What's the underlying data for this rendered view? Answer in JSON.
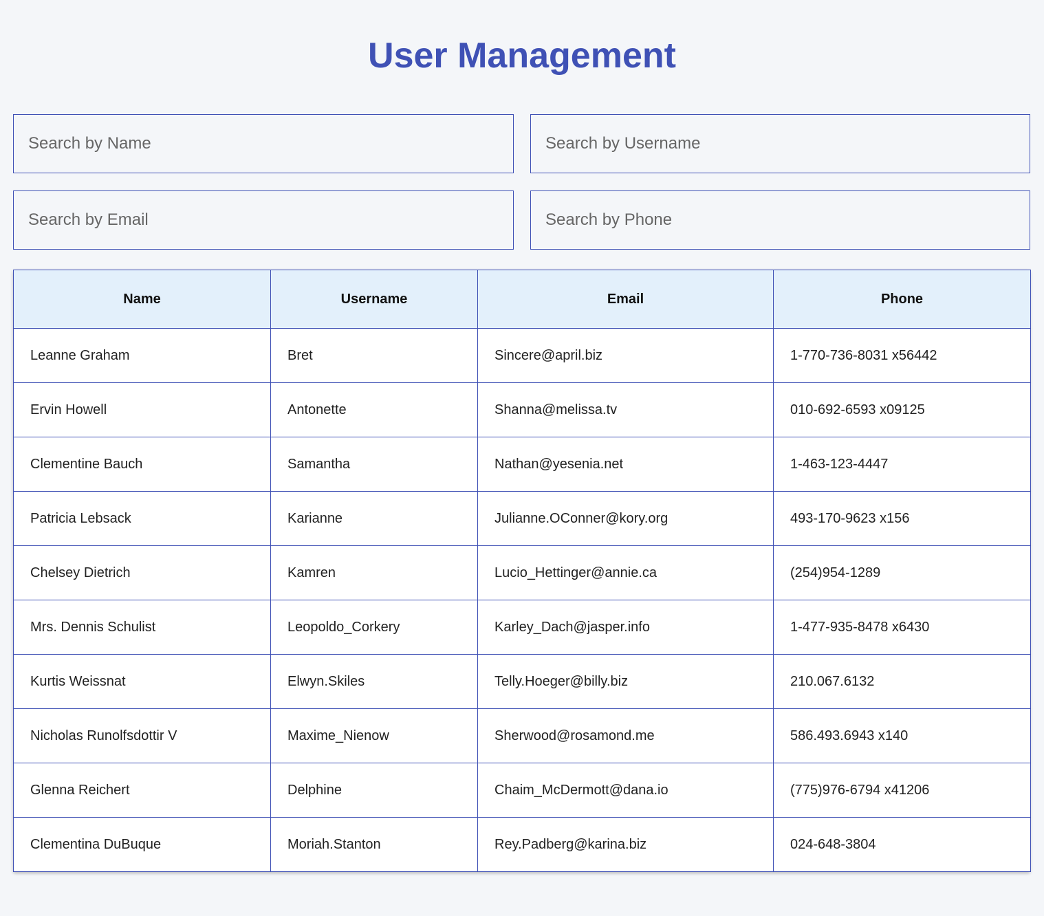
{
  "header": {
    "title": "User Management"
  },
  "filters": {
    "name_placeholder": "Search by Name",
    "username_placeholder": "Search by Username",
    "email_placeholder": "Search by Email",
    "phone_placeholder": "Search by Phone"
  },
  "table": {
    "columns": [
      "Name",
      "Username",
      "Email",
      "Phone"
    ],
    "rows": [
      [
        "Leanne Graham",
        "Bret",
        "Sincere@april.biz",
        "1-770-736-8031 x56442"
      ],
      [
        "Ervin Howell",
        "Antonette",
        "Shanna@melissa.tv",
        "010-692-6593 x09125"
      ],
      [
        "Clementine Bauch",
        "Samantha",
        "Nathan@yesenia.net",
        "1-463-123-4447"
      ],
      [
        "Patricia Lebsack",
        "Karianne",
        "Julianne.OConner@kory.org",
        "493-170-9623 x156"
      ],
      [
        "Chelsey Dietrich",
        "Kamren",
        "Lucio_Hettinger@annie.ca",
        "(254)954-1289"
      ],
      [
        "Mrs. Dennis Schulist",
        "Leopoldo_Corkery",
        "Karley_Dach@jasper.info",
        "1-477-935-8478 x6430"
      ],
      [
        "Kurtis Weissnat",
        "Elwyn.Skiles",
        "Telly.Hoeger@billy.biz",
        "210.067.6132"
      ],
      [
        "Nicholas Runolfsdottir V",
        "Maxime_Nienow",
        "Sherwood@rosamond.me",
        "586.493.6943 x140"
      ],
      [
        "Glenna Reichert",
        "Delphine",
        "Chaim_McDermott@dana.io",
        "(775)976-6794 x41206"
      ],
      [
        "Clementina DuBuque",
        "Moriah.Stanton",
        "Rey.Padberg@karina.biz",
        "024-648-3804"
      ]
    ]
  },
  "colors": {
    "accent": "#3f51b5",
    "header_bg": "#e3f0fb",
    "page_bg": "#f4f6f9"
  }
}
